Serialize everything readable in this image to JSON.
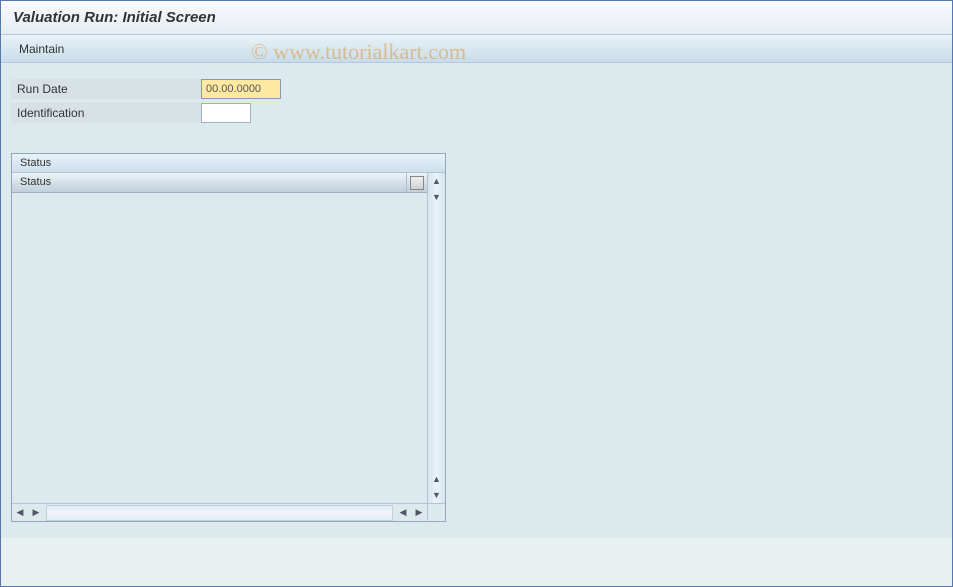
{
  "header": {
    "title": "Valuation Run: Initial Screen"
  },
  "toolbar": {
    "maintain_label": "Maintain"
  },
  "form": {
    "run_date_label": "Run Date",
    "run_date_value": "00.00.0000",
    "identification_label": "Identification",
    "identification_value": ""
  },
  "status_panel": {
    "panel_title": "Status",
    "column_header": "Status"
  },
  "watermark": {
    "text": "© www.tutorialkart.com"
  },
  "icons": {
    "up": "▲",
    "down": "▼",
    "left": "◀",
    "right": "▶"
  }
}
